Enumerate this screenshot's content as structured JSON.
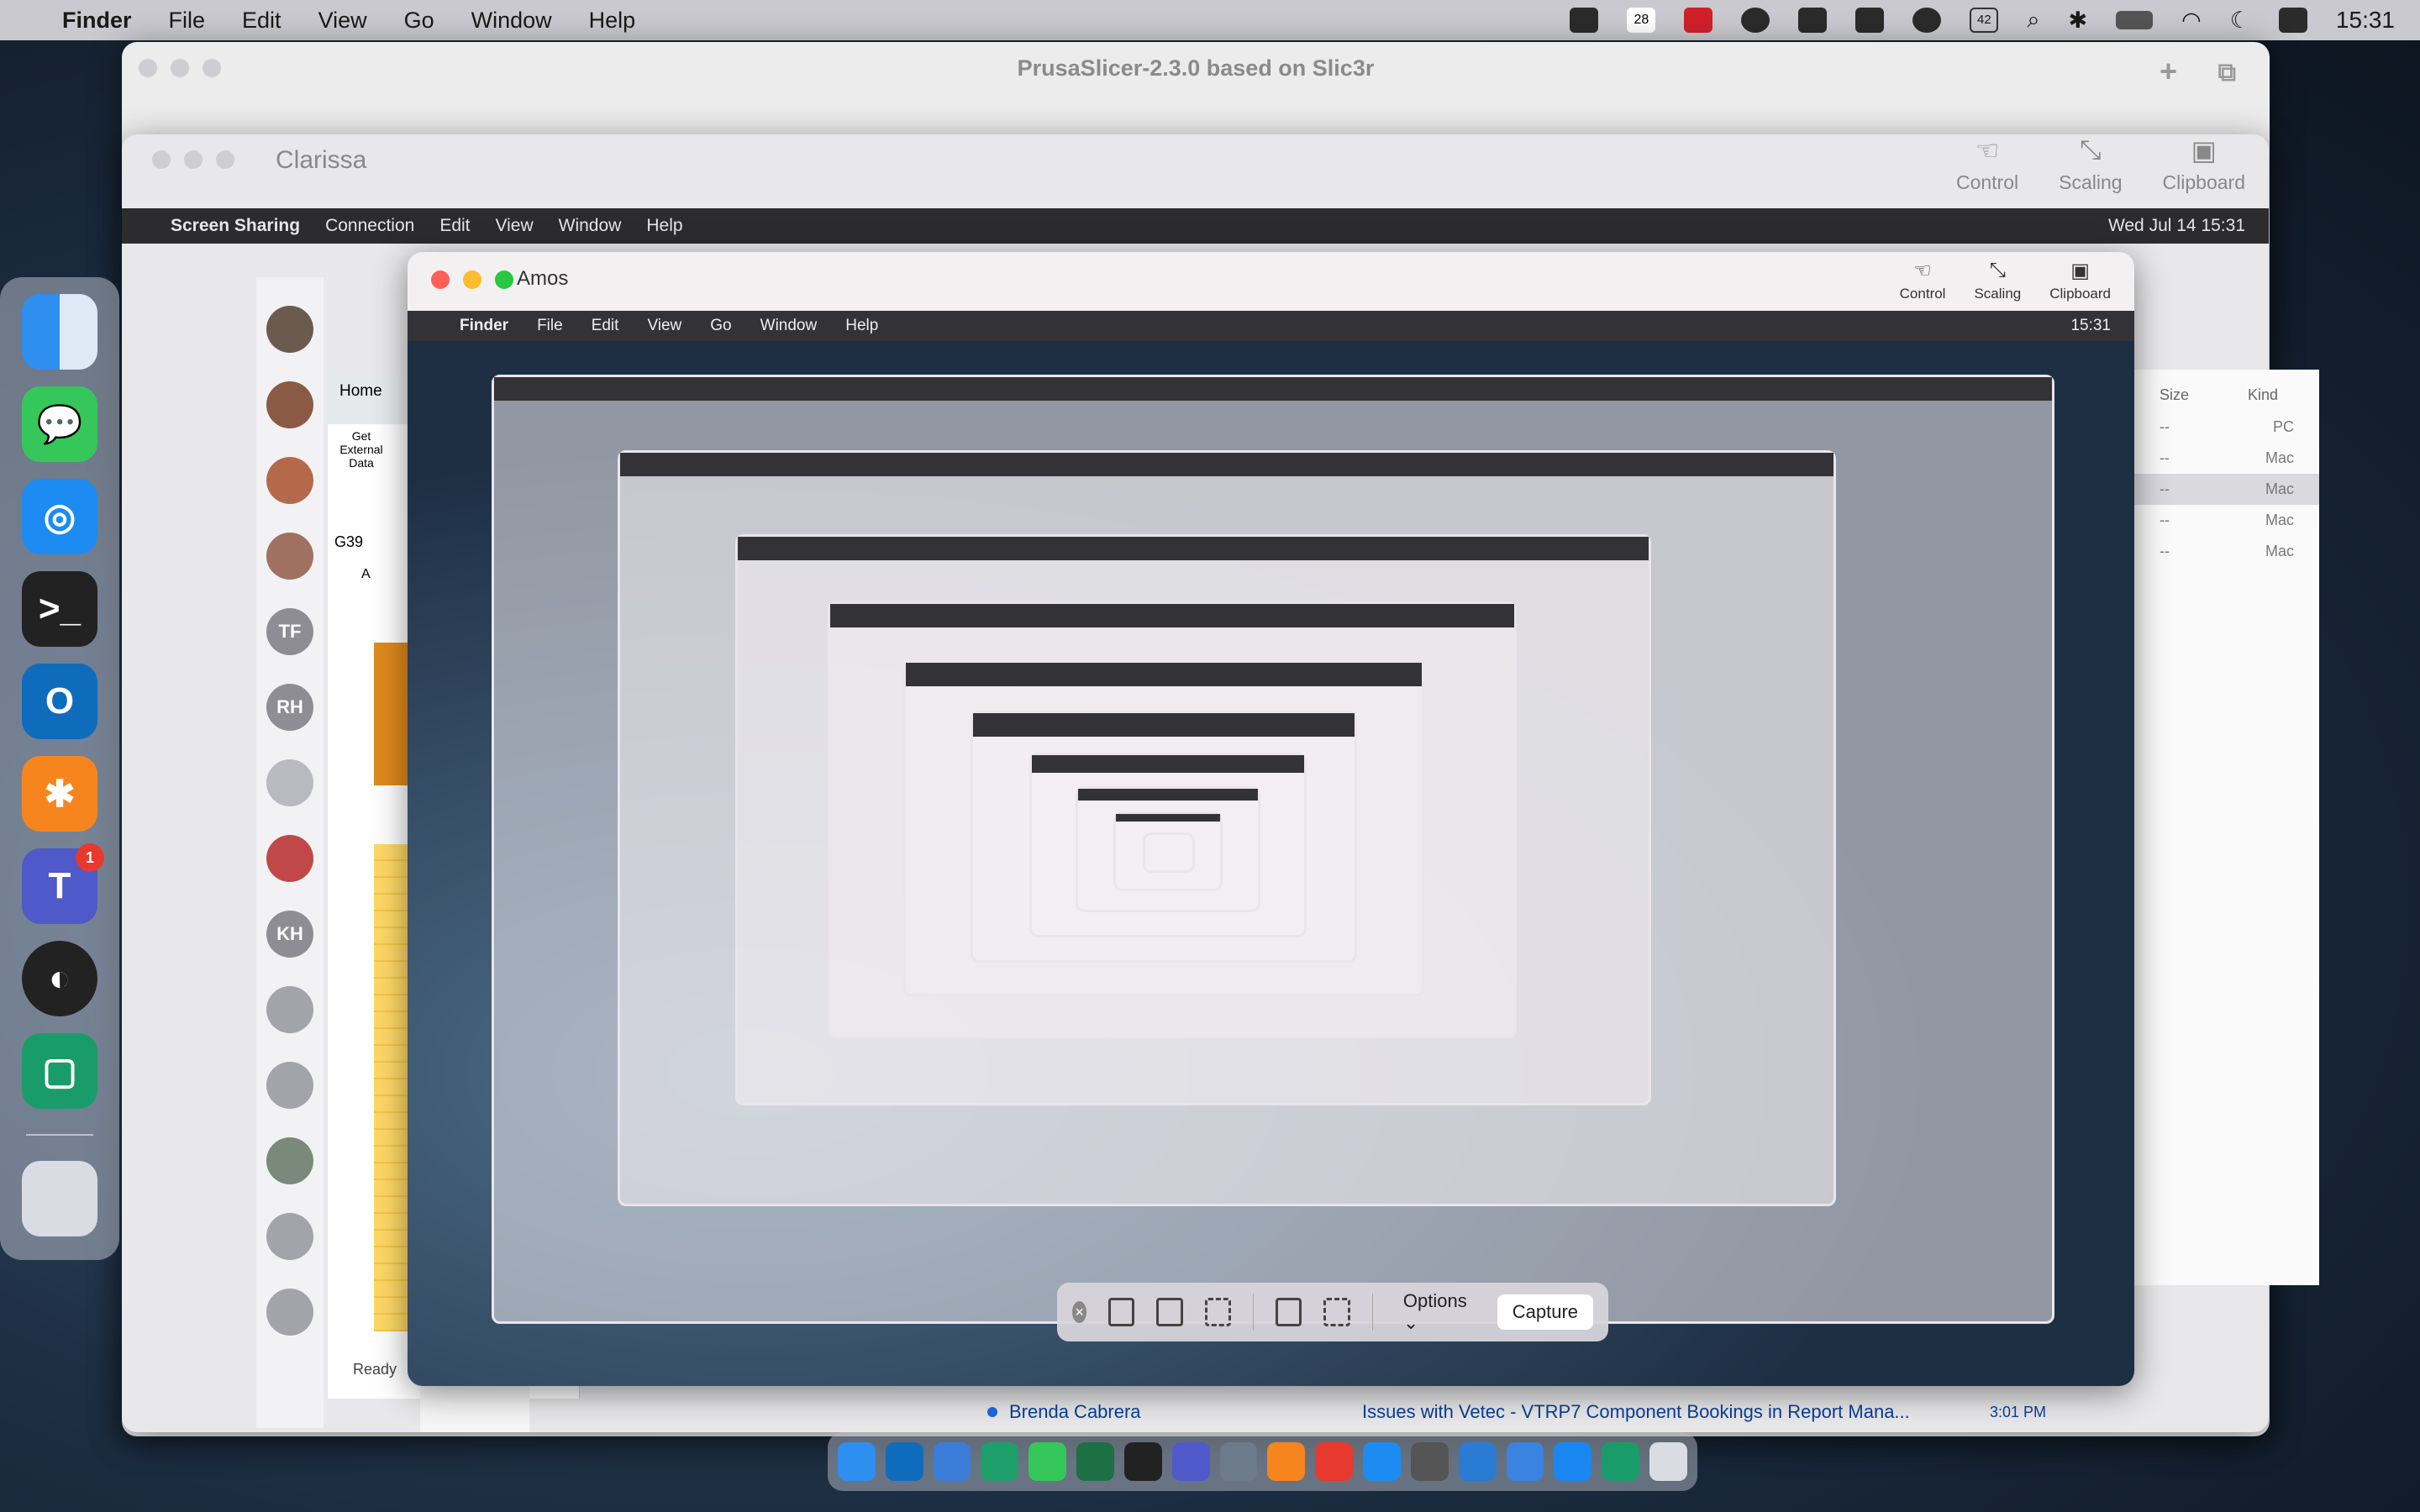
{
  "menubar": {
    "app": "Finder",
    "items": [
      "File",
      "Edit",
      "View",
      "Go",
      "Window",
      "Help"
    ],
    "status_badges": [
      "28",
      "42"
    ],
    "clock": "15:31"
  },
  "prusa_window": {
    "title": "PrusaSlicer-2.3.0 based on Slic3r"
  },
  "clarissa_window": {
    "title": "Clarissa",
    "tools": [
      {
        "icon": "control-icon",
        "label": "Control"
      },
      {
        "icon": "scaling-icon",
        "label": "Scaling"
      },
      {
        "icon": "clipboard-icon",
        "label": "Clipboard"
      }
    ]
  },
  "screen_sharing_bar": {
    "app": "Screen Sharing",
    "items": [
      "Connection",
      "Edit",
      "View",
      "Window",
      "Help"
    ],
    "clock": "Wed Jul 14  15:31"
  },
  "excel": {
    "tab": "Home",
    "get_data": "Get External Data",
    "cell_ref": "G39",
    "column": "A",
    "status": "Ready"
  },
  "teams_avatars": [
    "TF",
    "RH",
    "KH"
  ],
  "amos_window": {
    "title": "Amos",
    "tools": [
      {
        "icon": "control-icon",
        "label": "Control"
      },
      {
        "icon": "scaling-icon",
        "label": "Scaling"
      },
      {
        "icon": "clipboard-icon",
        "label": "Clipboard"
      }
    ],
    "bar_app": "Finder",
    "bar_items": [
      "File",
      "Edit",
      "View",
      "Go",
      "Window",
      "Help"
    ],
    "clock": "15:31"
  },
  "screenshot_toolbar": {
    "options_label": "Options",
    "capture_label": "Capture"
  },
  "mail": {
    "from": "Brenda Cabrera",
    "subject": "Issues with Vetec - VTRP7 Component Bookings in Report Mana...",
    "time": "3:01 PM"
  },
  "finder_fragment": {
    "headers": [
      "Size",
      "Kind"
    ],
    "rows": [
      {
        "size": "--",
        "kind": "PC"
      },
      {
        "size": "--",
        "kind": "Mac"
      },
      {
        "size": "--",
        "kind": "Mac"
      },
      {
        "size": "--",
        "kind": "Mac"
      },
      {
        "size": "--",
        "kind": "Mac"
      }
    ]
  },
  "dock": {
    "teams_badge": "1"
  },
  "colors": {
    "accent_blue": "#1b63d6",
    "badge_red": "#e8392e"
  }
}
